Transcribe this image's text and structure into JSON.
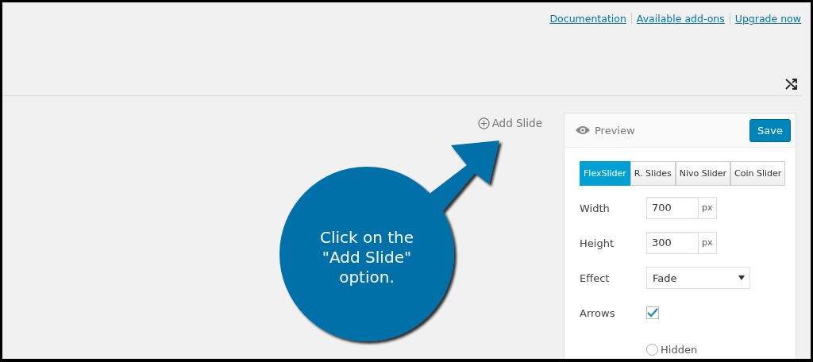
{
  "top_links": [
    "Documentation",
    "Available add-ons",
    "Upgrade now"
  ],
  "add_slide": "Add Slide",
  "callout": "Click on the \"Add Slide\" option.",
  "panel": {
    "title": "Preview",
    "save": "Save",
    "tabs": [
      {
        "label": "FlexSlider",
        "selected": true
      },
      {
        "label": "R. Slides",
        "selected": false
      },
      {
        "label": "Nivo Slider",
        "selected": false
      },
      {
        "label": "Coin Slider",
        "selected": false
      }
    ],
    "fields": [
      {
        "kind": "number",
        "label": "Width",
        "value": "700",
        "unit": "px"
      },
      {
        "kind": "number",
        "label": "Height",
        "value": "300",
        "unit": "px"
      },
      {
        "kind": "select",
        "label": "Effect",
        "value": "Fade"
      },
      {
        "kind": "checkbox",
        "label": "Arrows",
        "checked": true
      },
      {
        "kind": "radio",
        "option": "Hidden",
        "selected": false
      }
    ]
  }
}
